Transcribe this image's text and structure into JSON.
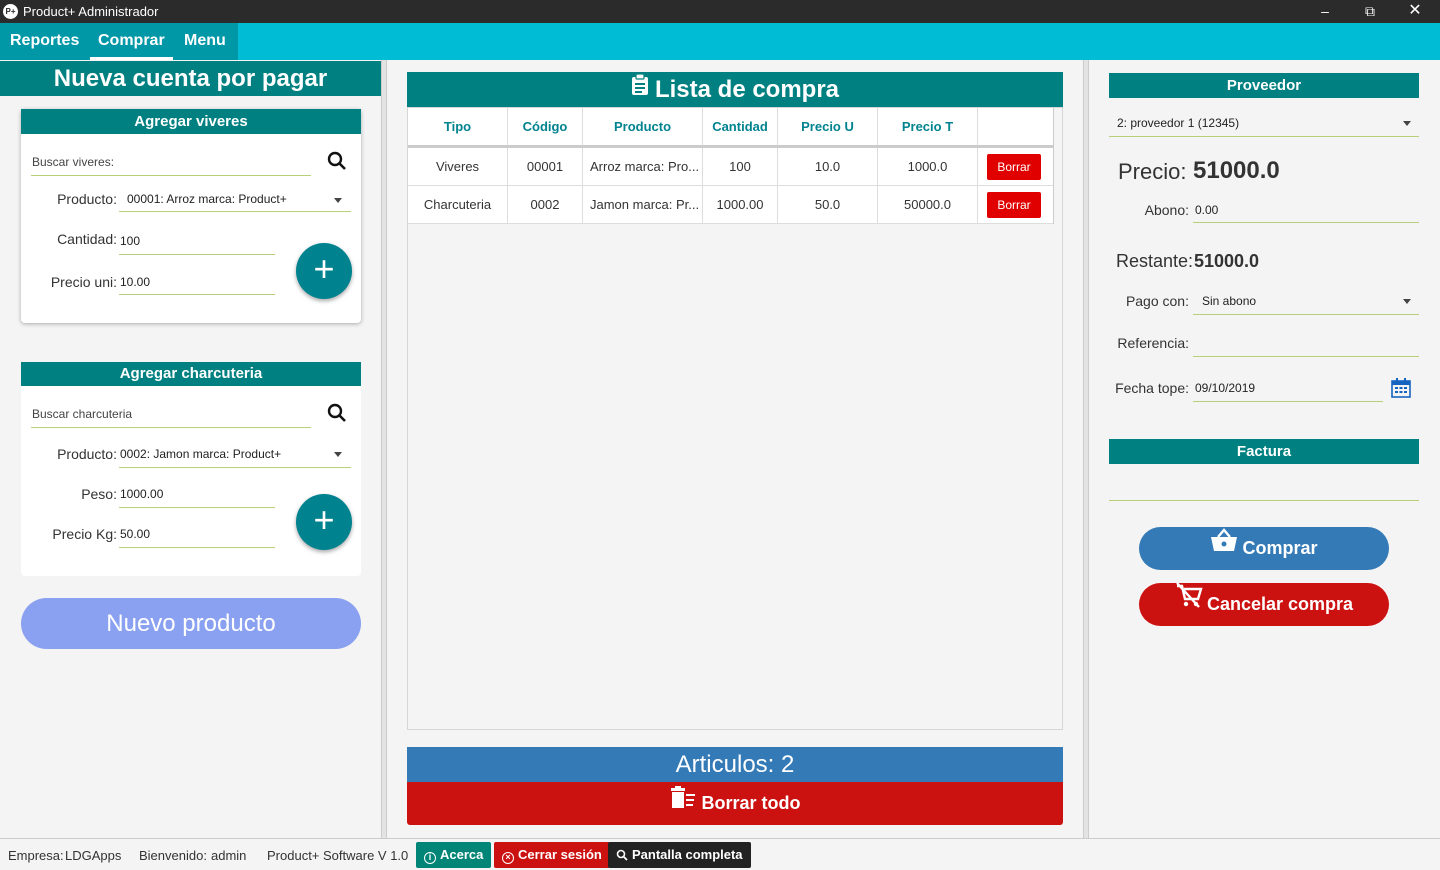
{
  "window": {
    "title": "Product+ Administrador",
    "icon_text": "P+"
  },
  "menubar": {
    "items": [
      "Reportes",
      "Comprar",
      "Menu"
    ],
    "active": "Comprar"
  },
  "left": {
    "title": "Nueva cuenta por pagar",
    "viveres": {
      "header": "Agregar viveres",
      "search_placeholder": "Buscar viveres:",
      "producto_label": "Producto:",
      "producto_value": "00001: Arroz marca: Product+",
      "cantidad_label": "Cantidad:",
      "cantidad_value": "100",
      "precio_label": "Precio uni:",
      "precio_value": "10.00"
    },
    "charcuteria": {
      "header": "Agregar charcuteria",
      "search_placeholder": "Buscar charcuteria",
      "producto_label": "Producto:",
      "producto_value": "0002: Jamon marca: Product+",
      "peso_label": "Peso:",
      "peso_value": "1000.00",
      "precio_label": "Precio Kg:",
      "precio_value": "50.00"
    },
    "nuevo_producto": "Nuevo producto"
  },
  "center": {
    "title": "Lista de compra",
    "columns": [
      "Tipo",
      "Código",
      "Producto",
      "Cantidad",
      "Precio U",
      "Precio T",
      ""
    ],
    "rows": [
      {
        "tipo": "Viveres",
        "codigo": "00001",
        "producto": "Arroz marca: Pro...",
        "cantidad": "100",
        "precio_u": "10.0",
        "precio_t": "1000.0",
        "action": "Borrar"
      },
      {
        "tipo": "Charcuteria",
        "codigo": "0002",
        "producto": "Jamon marca: Pr...",
        "cantidad": "1000.00",
        "precio_u": "50.0",
        "precio_t": "50000.0",
        "action": "Borrar"
      }
    ],
    "articulos": "Articulos: 2",
    "borrar_todo": "Borrar todo"
  },
  "right": {
    "proveedor_header": "Proveedor",
    "proveedor_value": "2: proveedor 1 (12345)",
    "precio_label": "Precio:",
    "precio_value": "51000.0",
    "abono_label": "Abono:",
    "abono_value": "0.00",
    "restante_label": "Restante:",
    "restante_value": "51000.0",
    "pago_label": "Pago con:",
    "pago_value": "Sin abono",
    "referencia_label": "Referencia:",
    "referencia_value": "",
    "fecha_label": "Fecha tope:",
    "fecha_value": "09/10/2019",
    "factura_header": "Factura",
    "comprar": "Comprar",
    "cancelar": "Cancelar compra"
  },
  "status": {
    "empresa_label": "Empresa:",
    "empresa_value": "LDGApps",
    "bienvenido_label": "Bienvenido:",
    "bienvenido_value": "admin",
    "version": "Product+ Software V 1.0",
    "acerca": "Acerca",
    "cerrar": "Cerrar sesión",
    "pantalla": "Pantalla completa"
  },
  "colors": {
    "teal": "#008080",
    "cyan_bar": "#00bcd4",
    "blue": "#337ab7",
    "red": "#cc1111",
    "lavender": "#8aa0f0"
  },
  "icons": [
    "search-icon",
    "chevron-down-icon",
    "plus-icon",
    "clipboard-icon",
    "trash-icon",
    "calendar-icon",
    "basket-icon",
    "cart-cancel-icon",
    "info-icon",
    "close-circle-icon",
    "magnifier-icon"
  ]
}
